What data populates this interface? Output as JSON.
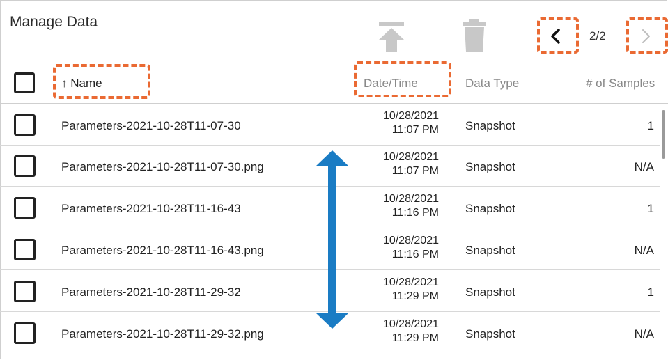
{
  "header": {
    "title": "Manage Data",
    "page_indicator": "2/2",
    "icons": {
      "upload": "upload-icon",
      "delete": "trash-icon",
      "prev": "chevron-left-icon",
      "next": "chevron-right-icon"
    }
  },
  "columns": {
    "name": "↑ Name",
    "datetime": "Date/Time",
    "type": "Data Type",
    "samples": "# of Samples"
  },
  "rows": [
    {
      "name": "Parameters-2021-10-28T11-07-30",
      "date": "10/28/2021",
      "time": "11:07 PM",
      "type": "Snapshot",
      "samples": "1"
    },
    {
      "name": "Parameters-2021-10-28T11-07-30.png",
      "date": "10/28/2021",
      "time": "11:07 PM",
      "type": "Snapshot",
      "samples": "N/A"
    },
    {
      "name": "Parameters-2021-10-28T11-16-43",
      "date": "10/28/2021",
      "time": "11:16 PM",
      "type": "Snapshot",
      "samples": "1"
    },
    {
      "name": "Parameters-2021-10-28T11-16-43.png",
      "date": "10/28/2021",
      "time": "11:16 PM",
      "type": "Snapshot",
      "samples": "N/A"
    },
    {
      "name": "Parameters-2021-10-28T11-29-32",
      "date": "10/28/2021",
      "time": "11:29 PM",
      "type": "Snapshot",
      "samples": "1"
    },
    {
      "name": "Parameters-2021-10-28T11-29-32.png",
      "date": "10/28/2021",
      "time": "11:29 PM",
      "type": "Snapshot",
      "samples": "N/A"
    }
  ],
  "colors": {
    "highlight": "#ea6a33",
    "arrow": "#1a7cc4",
    "disabled_icon": "#c8c8c8"
  }
}
